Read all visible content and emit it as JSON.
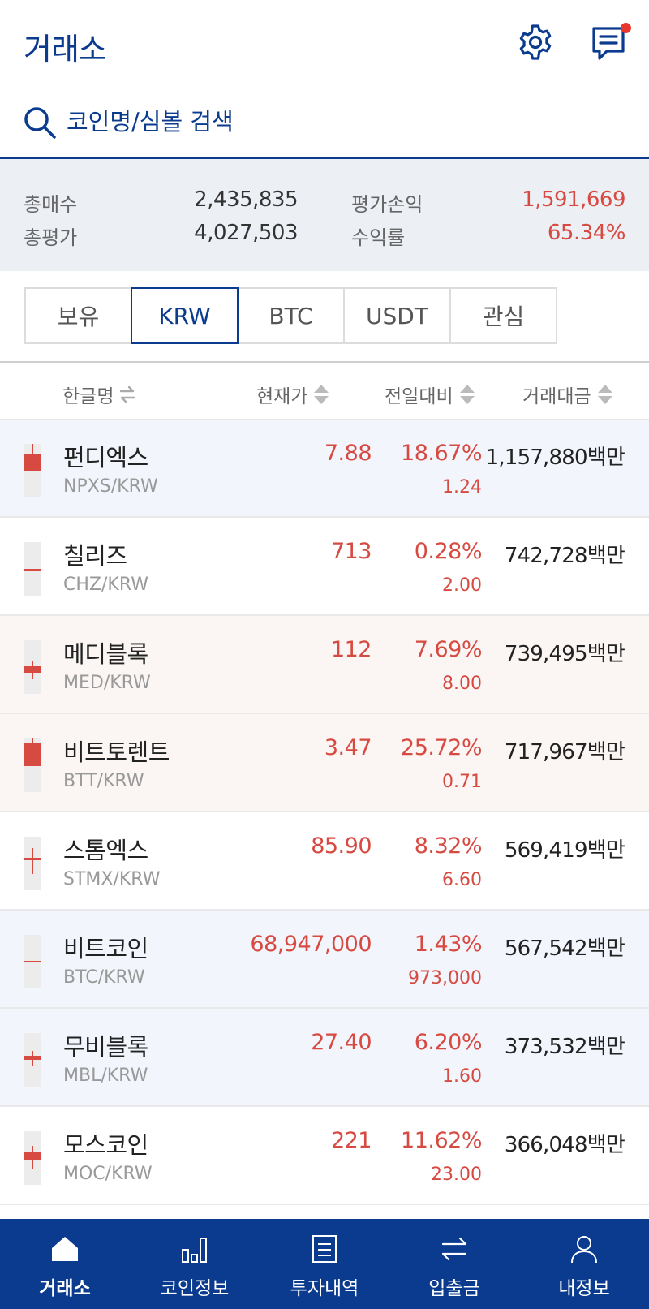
{
  "header": {
    "title": "거래소",
    "settings_icon": "gear-icon",
    "messages_icon": "chat-icon",
    "notification": true
  },
  "search": {
    "placeholder": "코인명/심볼 검색",
    "value": ""
  },
  "summary": {
    "total_buy_label": "총매수",
    "total_buy": "2,435,835",
    "total_eval_label": "총평가",
    "total_eval": "4,027,503",
    "pnl_label": "평가손익",
    "pnl": "1,591,669",
    "return_label": "수익률",
    "return": "65.34%"
  },
  "tabs": [
    {
      "label": "보유",
      "active": false
    },
    {
      "label": "KRW",
      "active": true
    },
    {
      "label": "BTC",
      "active": false
    },
    {
      "label": "USDT",
      "active": false
    },
    {
      "label": "관심",
      "active": false
    }
  ],
  "columns": {
    "name": "한글명",
    "price": "현재가",
    "change": "전일대비",
    "volume": "거래대금"
  },
  "coins": [
    {
      "name": "펀디엑스",
      "symbol": "NPXS/KRW",
      "price": "7.88",
      "change_pct": "18.67%",
      "change_amt": "1.24",
      "volume": "1,157,880백만",
      "highlight": "blue"
    },
    {
      "name": "칠리즈",
      "symbol": "CHZ/KRW",
      "price": "713",
      "change_pct": "0.28%",
      "change_amt": "2.00",
      "volume": "742,728백만",
      "highlight": "none"
    },
    {
      "name": "메디블록",
      "symbol": "MED/KRW",
      "price": "112",
      "change_pct": "7.69%",
      "change_amt": "8.00",
      "volume": "739,495백만",
      "highlight": "pink"
    },
    {
      "name": "비트토렌트",
      "symbol": "BTT/KRW",
      "price": "3.47",
      "change_pct": "25.72%",
      "change_amt": "0.71",
      "volume": "717,967백만",
      "highlight": "pink"
    },
    {
      "name": "스톰엑스",
      "symbol": "STMX/KRW",
      "price": "85.90",
      "change_pct": "8.32%",
      "change_amt": "6.60",
      "volume": "569,419백만",
      "highlight": "none"
    },
    {
      "name": "비트코인",
      "symbol": "BTC/KRW",
      "price": "68,947,000",
      "change_pct": "1.43%",
      "change_amt": "973,000",
      "volume": "567,542백만",
      "highlight": "blue"
    },
    {
      "name": "무비블록",
      "symbol": "MBL/KRW",
      "price": "27.40",
      "change_pct": "6.20%",
      "change_amt": "1.60",
      "volume": "373,532백만",
      "highlight": "blue"
    },
    {
      "name": "모스코인",
      "symbol": "MOC/KRW",
      "price": "221",
      "change_pct": "11.62%",
      "change_amt": "23.00",
      "volume": "366,048백만",
      "highlight": "none"
    }
  ],
  "nav": [
    {
      "label": "거래소",
      "icon": "home-icon",
      "active": true
    },
    {
      "label": "코인정보",
      "icon": "bar-chart-icon",
      "active": false
    },
    {
      "label": "투자내역",
      "icon": "document-icon",
      "active": false
    },
    {
      "label": "입출금",
      "icon": "transfer-icon",
      "active": false
    },
    {
      "label": "내정보",
      "icon": "user-icon",
      "active": false
    }
  ],
  "colors": {
    "brand": "#0a3b8f",
    "up": "#d64a42",
    "row_blue": "#f2f6fc",
    "row_pink": "#fbf5f4"
  }
}
